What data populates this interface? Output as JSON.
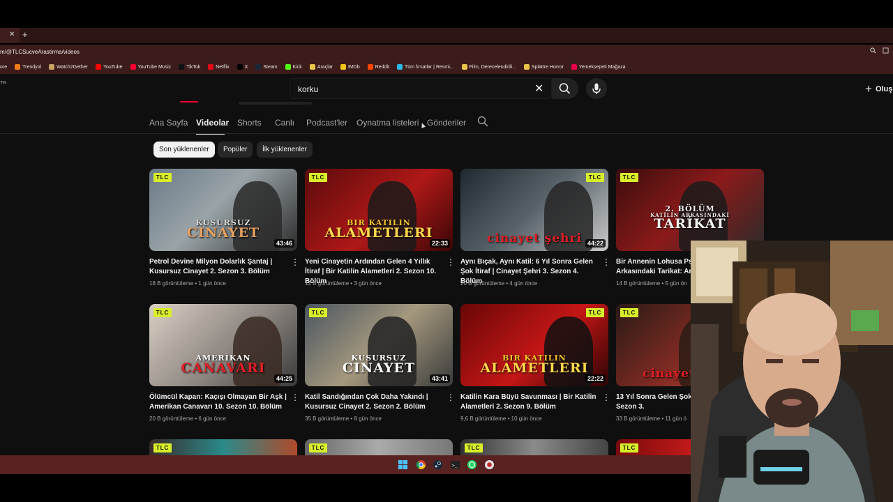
{
  "browser": {
    "tab_close": "✕",
    "new_tab": "+",
    "url": "m/@TLCSucveArastirma/videos",
    "bookmarks": [
      {
        "label": "ore",
        "color": "#888888"
      },
      {
        "label": "Trendyol",
        "color": "#f27a1a"
      },
      {
        "label": "Watch2Gether",
        "color": "#c8a464"
      },
      {
        "label": "YouTube",
        "color": "#ff0000"
      },
      {
        "label": "YouTube Music",
        "color": "#ff0033"
      },
      {
        "label": "TikTok",
        "color": "#111111"
      },
      {
        "label": "Netflix",
        "color": "#e50914"
      },
      {
        "label": "X",
        "color": "#000000"
      },
      {
        "label": "Steam",
        "color": "#1b2838"
      },
      {
        "label": "Kick",
        "color": "#53fc18"
      },
      {
        "label": "Araçlar",
        "color": "#e8c54a"
      },
      {
        "label": "IMDb",
        "color": "#f5c518"
      },
      {
        "label": "Reddit",
        "color": "#ff4500"
      },
      {
        "label": "Tüm fırsatlar | Resmi...",
        "color": "#2bbbe8"
      },
      {
        "label": "Film, Derecelendirili...",
        "color": "#e8c54a"
      },
      {
        "label": "Splattre Horror",
        "color": "#e8c54a"
      },
      {
        "label": "Yemeksepeti Mağaza",
        "color": "#ea004b"
      }
    ]
  },
  "youtube": {
    "country_code": "TR",
    "search": {
      "value": "korku",
      "clear": "✕"
    },
    "create_label": "Oluş",
    "channel_tabs": [
      "Ana Sayfa",
      "Videolar",
      "Shorts",
      "Canlı",
      "Podcast'ler",
      "Oynatma listeleri",
      "Gönderiler"
    ],
    "active_tab": "Videolar",
    "chips": [
      "Son yüklenenler",
      "Popüler",
      "İlk yüklenenler"
    ],
    "active_chip": "Son yüklenenler",
    "badge": "TLC",
    "videos": [
      {
        "series": "KUSURSUZ|CINAYET",
        "duration": "43:46",
        "title": "Petrol Devine Milyon Dolarlık Şantaj | Kusursuz Cinayet 2. Sezon 3. Bölüm",
        "views": "18 B görüntüleme",
        "age": "1 gün önce"
      },
      {
        "series": "BIR KATILIN|ALAMETLERI",
        "duration": "22:33",
        "title": "Yeni Cinayetin Ardından Gelen 4 Yıllık İtiraf | Bir Katilin Alametleri 2. Sezon 10. Bölüm",
        "views": "12 B görüntüleme",
        "age": "3 gün önce"
      },
      {
        "series": "cinayet şehri",
        "duration": "44:22",
        "title": "Aynı Bıçak, Aynı Katil: 6 Yıl Sonra Gelen Şok İtiraf | Cinayet Şehri 3. Sezon 4. Bölüm",
        "views": "20 B görüntüleme",
        "age": "4 gün önce"
      },
      {
        "series": "2. BÖLÜM|KATİLİN ARKASINDAKİ|TARİKAT",
        "duration": "",
        "title": "Bir Annenin Lohusa Psikozu | Katilin Arkasındaki Tarikat: And",
        "views": "14 B görüntüleme",
        "age": "5 gün ön"
      },
      {
        "series": "AMERİKAN|CANAVARI",
        "duration": "44:25",
        "title": "Ölümcül Kapan: Kaçışı Olmayan Bir Aşk | Amerikan Canavarı 10. Sezon 10. Bölüm",
        "views": "20 B görüntüleme",
        "age": "6 gün önce"
      },
      {
        "series": "KUSURSUZ|CINAYET",
        "duration": "43:41",
        "title": "Katil Sandığından Çok Daha Yakındı | Kusursuz Cinayet 2. Sezon 2. Bölüm",
        "views": "35 B görüntüleme",
        "age": "8 gün önce"
      },
      {
        "series": "BIR KATILIN|ALAMETLERI",
        "duration": "22:22",
        "title": "Katilin Kara Büyü Savunması | Bir Katilin Alametleri 2. Sezon 9. Bölüm",
        "views": "9,6 B görüntüleme",
        "age": "10 gün önce"
      },
      {
        "series": "cinayet şehri",
        "duration": "",
        "title": "13 Yıl Sonra Gelen Şok D Cinayet Şehri 3. Sezon 3.",
        "views": "33 B görüntüleme",
        "age": "11 gün ö"
      }
    ]
  }
}
